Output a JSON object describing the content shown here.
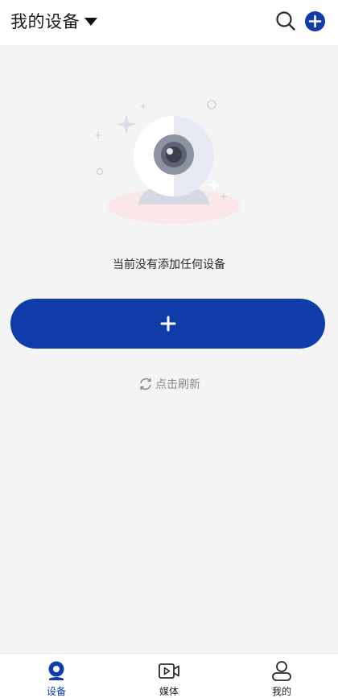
{
  "header": {
    "title": "我的设备",
    "icons": {
      "dropdown": "caret-down-icon",
      "search": "search-icon",
      "add": "plus-circle-icon"
    }
  },
  "empty_state": {
    "illustration": "webcam-illustration",
    "message": "当前没有添加任何设备"
  },
  "add_button": {
    "icon": "plus-icon"
  },
  "refresh": {
    "label": "点击刷新",
    "icon": "refresh-icon"
  },
  "tabs": [
    {
      "label": "设备",
      "icon": "camera-icon",
      "active": true
    },
    {
      "label": "媒体",
      "icon": "video-icon",
      "active": false
    },
    {
      "label": "我的",
      "icon": "person-icon",
      "active": false
    }
  ],
  "colors": {
    "accent": "#0f3ca8",
    "background": "#f4f4f5",
    "header_bg": "#ffffff",
    "muted_text": "#8a8a8a"
  }
}
